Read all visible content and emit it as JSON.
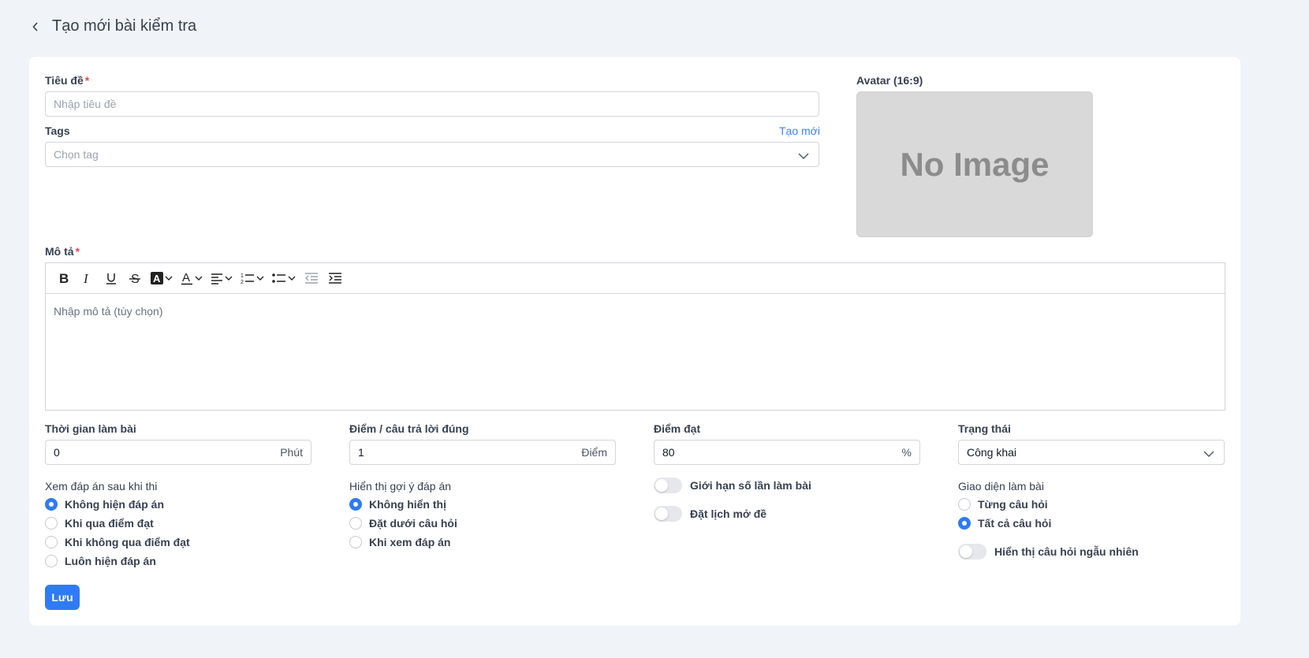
{
  "header": {
    "title": "Tạo mới bài kiểm tra"
  },
  "form": {
    "title_label": "Tiêu đề",
    "title_placeholder": "Nhập tiêu đề",
    "tags_label": "Tags",
    "tags_create": "Tạo mới",
    "tags_placeholder": "Chọn tag",
    "avatar_label": "Avatar (16:9)",
    "avatar_text": "No Image",
    "desc_label": "Mô tả",
    "desc_placeholder": "Nhập mô tả (tùy chọn)",
    "required_mark": "*"
  },
  "toolbar": {
    "buttons": [
      "bold-icon",
      "italic-icon",
      "underline-icon",
      "strikethrough-icon",
      "highlight-icon",
      "text-color-icon",
      "align-left-icon",
      "ordered-list-icon",
      "bullet-list-icon",
      "outdent-icon",
      "indent-icon"
    ]
  },
  "fields": {
    "time_label": "Thời gian làm bài",
    "time_value": "0",
    "time_unit": "Phút",
    "points_label": "Điểm / câu trả lời đúng",
    "points_value": "1",
    "points_unit": "Điểm",
    "pass_label": "Điểm đạt",
    "pass_value": "80",
    "pass_unit": "%",
    "status_label": "Trạng thái",
    "status_value": "Công khai"
  },
  "show_answer": {
    "label": "Xem đáp án sau khi thi",
    "options": [
      "Không hiện đáp án",
      "Khi qua điểm đạt",
      "Khi không qua điểm đạt",
      "Luôn hiện đáp án"
    ],
    "selected": 0
  },
  "hint": {
    "label": "Hiển thị gợi ý đáp án",
    "options": [
      "Không hiển thị",
      "Đặt dưới câu hỏi",
      "Khi xem đáp án"
    ],
    "selected": 0
  },
  "toggles": {
    "limit_attempts": "Giới hạn số lần làm bài",
    "schedule": "Đặt lịch mở đề",
    "random_order": "Hiển thị câu hỏi ngẫu nhiên"
  },
  "layout_mode": {
    "label": "Giao diện làm bài",
    "options": [
      "Từng câu hỏi",
      "Tất cả câu hỏi"
    ],
    "selected": 1
  },
  "save_label": "Lưu",
  "colors": {
    "primary": "#2f7bf5",
    "background": "#f0f3f7"
  }
}
